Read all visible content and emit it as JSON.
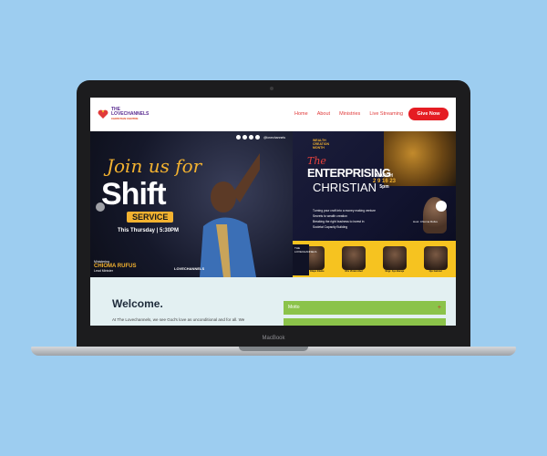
{
  "device": {
    "model_label": "MacBook"
  },
  "site": {
    "logo": {
      "line1": "THE",
      "line2": "LOVECHANNELS",
      "tagline": "CHRISTIAN CENTRE"
    },
    "nav": [
      "Home",
      "About",
      "Ministries",
      "Live Streaming"
    ],
    "give_button": "Give Now"
  },
  "banner_left": {
    "join": "Join us for",
    "shift": "Shift",
    "service": "SERVICE",
    "time": "This Thursday  |  5:30PM",
    "handle": "@lovechannels",
    "minister_intro": "Ministering",
    "minister_name": "CHIOMA RUFUS",
    "minister_role": "Lead Minister",
    "brand": "LOVECHANNELS"
  },
  "banner_right": {
    "series": [
      "WEALTH",
      "CREATION",
      "MONTH"
    ],
    "the": "The",
    "title1": "ENTERPRISING",
    "title2": "CHRISTIAN",
    "month": "MARCH",
    "dates": "2 9 16 23",
    "time": "5pm",
    "bullets": [
      "Turning your craft into a money making venture",
      "Secrets to wealth creation",
      "Breaking the right business to invest in",
      "Societal Capacity Building"
    ],
    "host_label": "Host: Chioma Rufus",
    "speakers": [
      "Pastor Olapo Elaine",
      "Mrs Vivian Abel",
      "Engr. Ayo Baraje",
      "Ojo Gabriel"
    ],
    "tag": "THE LOVECHANNELS"
  },
  "welcome": {
    "title": "Welcome.",
    "body": "At The Lovechannels, we see God's love as unconditional and for all. We",
    "accordion": [
      "Motto",
      ""
    ]
  },
  "colors": {
    "accent": "#e51c23",
    "gold": "#f3b230",
    "green": "#8bc34a",
    "background": "#9dcdf0"
  }
}
